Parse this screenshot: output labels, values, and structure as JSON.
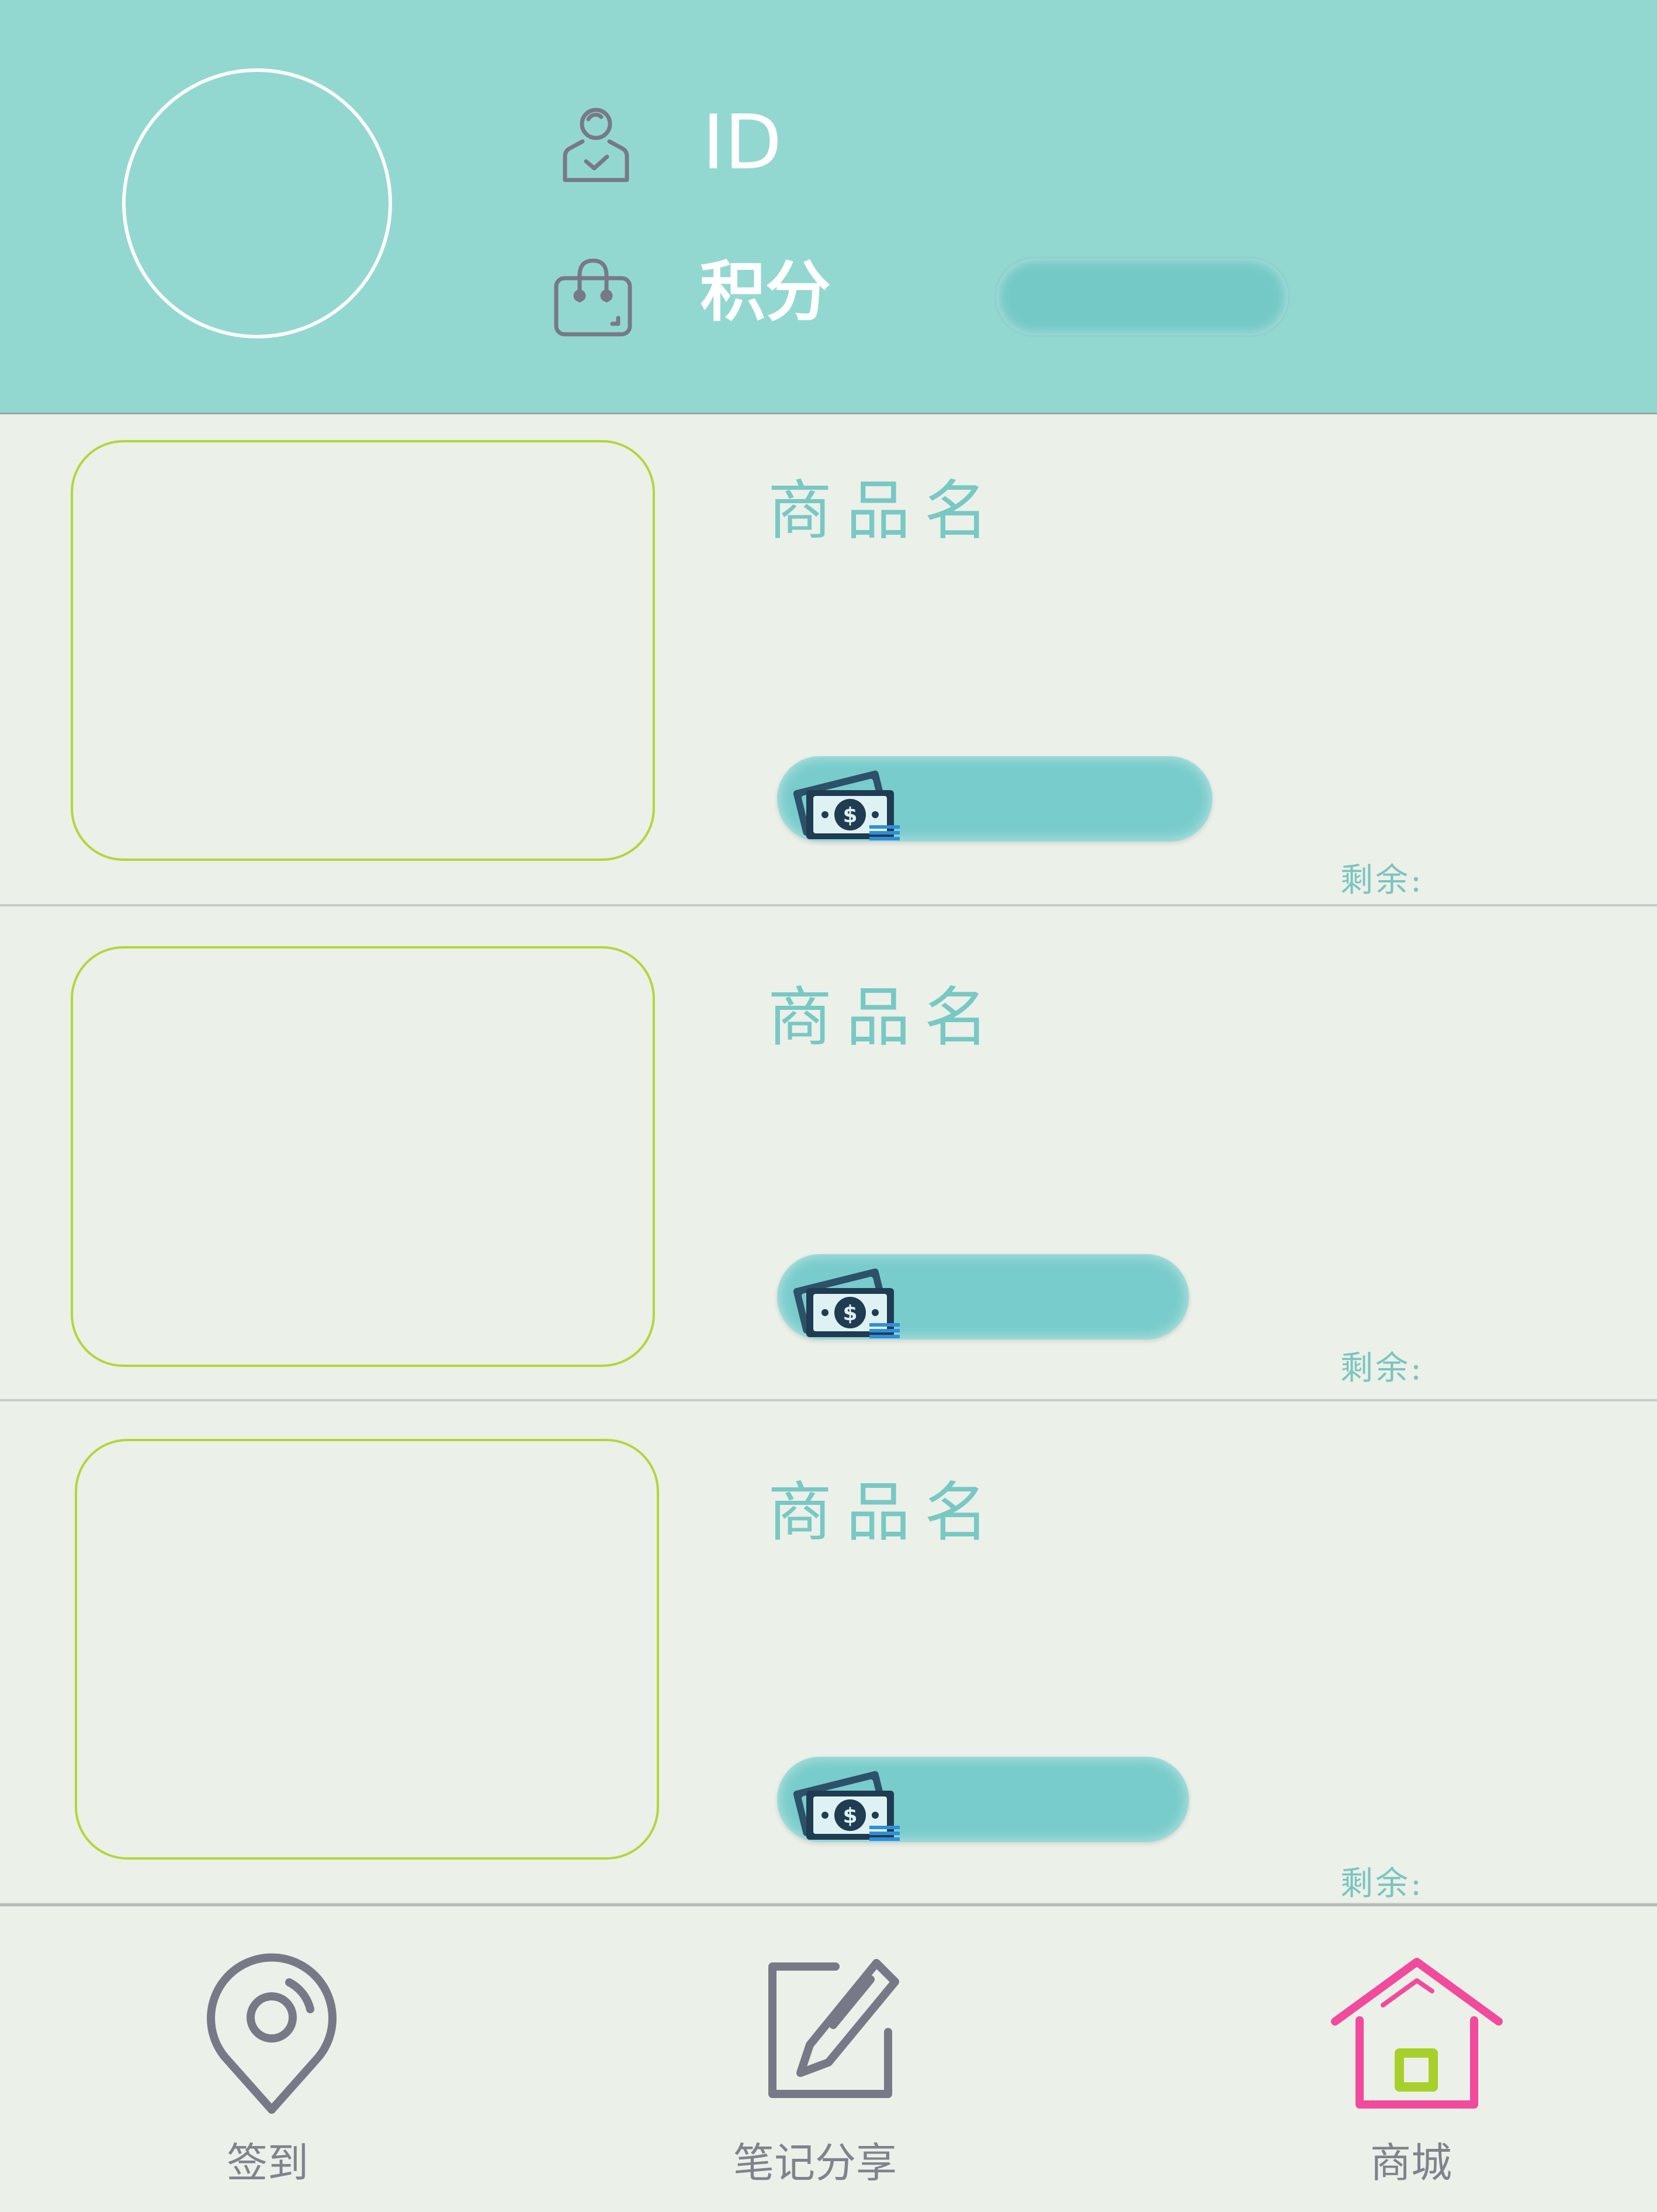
{
  "header": {
    "id_label": "ID",
    "points_label": "积分",
    "avatar_icon": "avatar-circle",
    "id_icon": "user-icon",
    "points_icon": "bag-icon"
  },
  "products": [
    {
      "name": "商品名",
      "remain_label": "剩余:",
      "price_icon": "money-icon"
    },
    {
      "name": "商品名",
      "remain_label": "剩余:",
      "price_icon": "money-icon"
    },
    {
      "name": "商品名",
      "remain_label": "剩余:",
      "price_icon": "money-icon"
    }
  ],
  "tabbar": {
    "tabs": [
      {
        "label": "签到",
        "icon": "location-pin-icon",
        "active": false
      },
      {
        "label": "笔记分享",
        "icon": "edit-pencil-icon",
        "active": false
      },
      {
        "label": "商城",
        "icon": "home-icon",
        "active": true
      }
    ]
  },
  "colors": {
    "header_bg": "#92d8d1",
    "page_bg": "#ebf0e9",
    "accent_teal": "#78cccb",
    "image_border": "#b3d63a",
    "active_tab": "#f24a9c",
    "inactive_tab": "#80838c"
  }
}
